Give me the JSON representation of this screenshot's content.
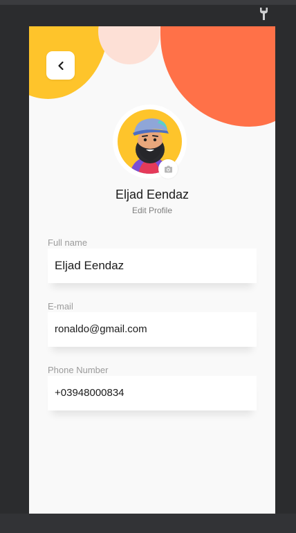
{
  "colors": {
    "yellow": "#fec42b",
    "orange": "#ff7148",
    "peach": "#fde0d6",
    "background": "#f9f9f9",
    "dark_frame": "#2b2c2e"
  },
  "icons": {
    "toolbar": "wrench-icon",
    "back": "chevron-left-icon",
    "camera": "camera-icon"
  },
  "profile": {
    "name": "Eljad Eendaz",
    "edit_label": "Edit Profile"
  },
  "fields": {
    "full_name": {
      "label": "Full name",
      "value": "Eljad Eendaz"
    },
    "email": {
      "label": "E-mail",
      "value": "ronaldo@gmail.com"
    },
    "phone": {
      "label": "Phone Number",
      "value": "+03948000834"
    }
  }
}
